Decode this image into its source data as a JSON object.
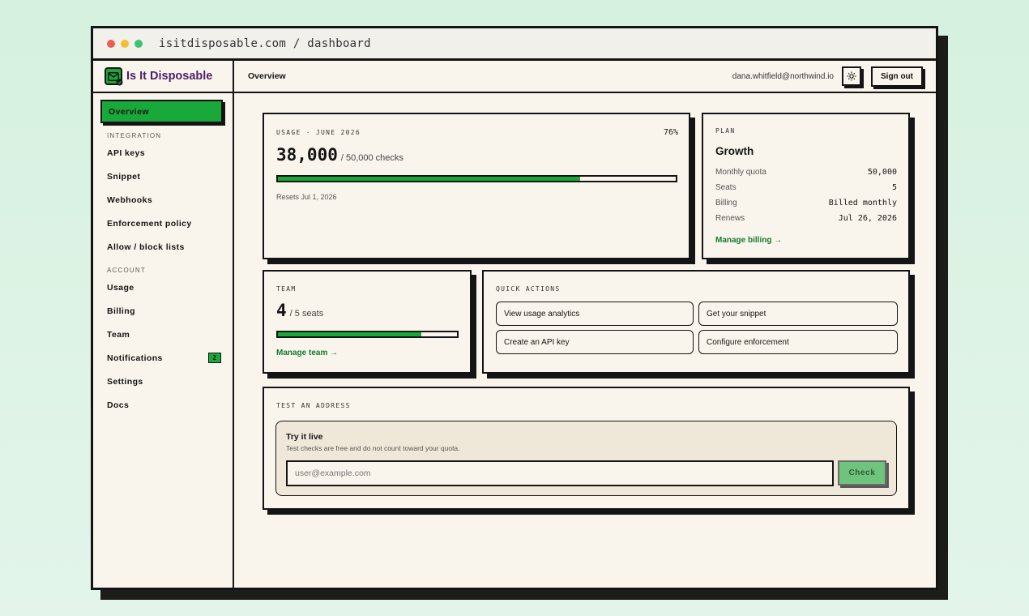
{
  "browser": {
    "url": "isitdisposable.com / dashboard"
  },
  "brand": {
    "name": "Is It Disposable",
    "icon": "mail-check-icon",
    "color": "#4b1f6e",
    "accent": "#19a83a"
  },
  "sidebar": {
    "active": "Overview",
    "overview": "Overview",
    "sections": {
      "integration": "INTEGRATION",
      "account": "ACCOUNT"
    },
    "integration_items": [
      "API keys",
      "Snippet",
      "Webhooks",
      "Enforcement policy",
      "Allow / block lists"
    ],
    "account_items": [
      "Usage",
      "Billing",
      "Team",
      "Notifications",
      "Settings",
      "Docs"
    ],
    "notifications_badge": "2"
  },
  "topbar": {
    "title": "Overview",
    "email": "dana.whitfield@northwind.io",
    "theme_icon": "sun-icon",
    "signout": "Sign out"
  },
  "usage": {
    "label": "USAGE · JUNE 2026",
    "percent": "76%",
    "value": "38,000",
    "unit": "/ 50,000 checks",
    "fill": 0.76,
    "reset": "Resets Jul 1, 2026"
  },
  "plan": {
    "label": "PLAN",
    "name": "Growth",
    "rows": [
      {
        "k": "Monthly quota",
        "v": "50,000"
      },
      {
        "k": "Seats",
        "v": "5"
      },
      {
        "k": "Billing",
        "v": "Billed monthly"
      },
      {
        "k": "Renews",
        "v": "Jul 26, 2026"
      }
    ],
    "link": "Manage billing →"
  },
  "team": {
    "label": "TEAM",
    "value": "4",
    "unit": "/ 5 seats",
    "fill": 0.8,
    "link": "Manage team →"
  },
  "quick_actions": {
    "label": "QUICK ACTIONS",
    "buttons": [
      "View usage analytics",
      "Get your snippet",
      "Create an API key",
      "Configure enforcement"
    ]
  },
  "test": {
    "label": "TEST AN ADDRESS",
    "title": "Try it live",
    "subtitle": "Test checks are free and do not count toward your quota.",
    "placeholder": "user@example.com",
    "button": "Check"
  }
}
